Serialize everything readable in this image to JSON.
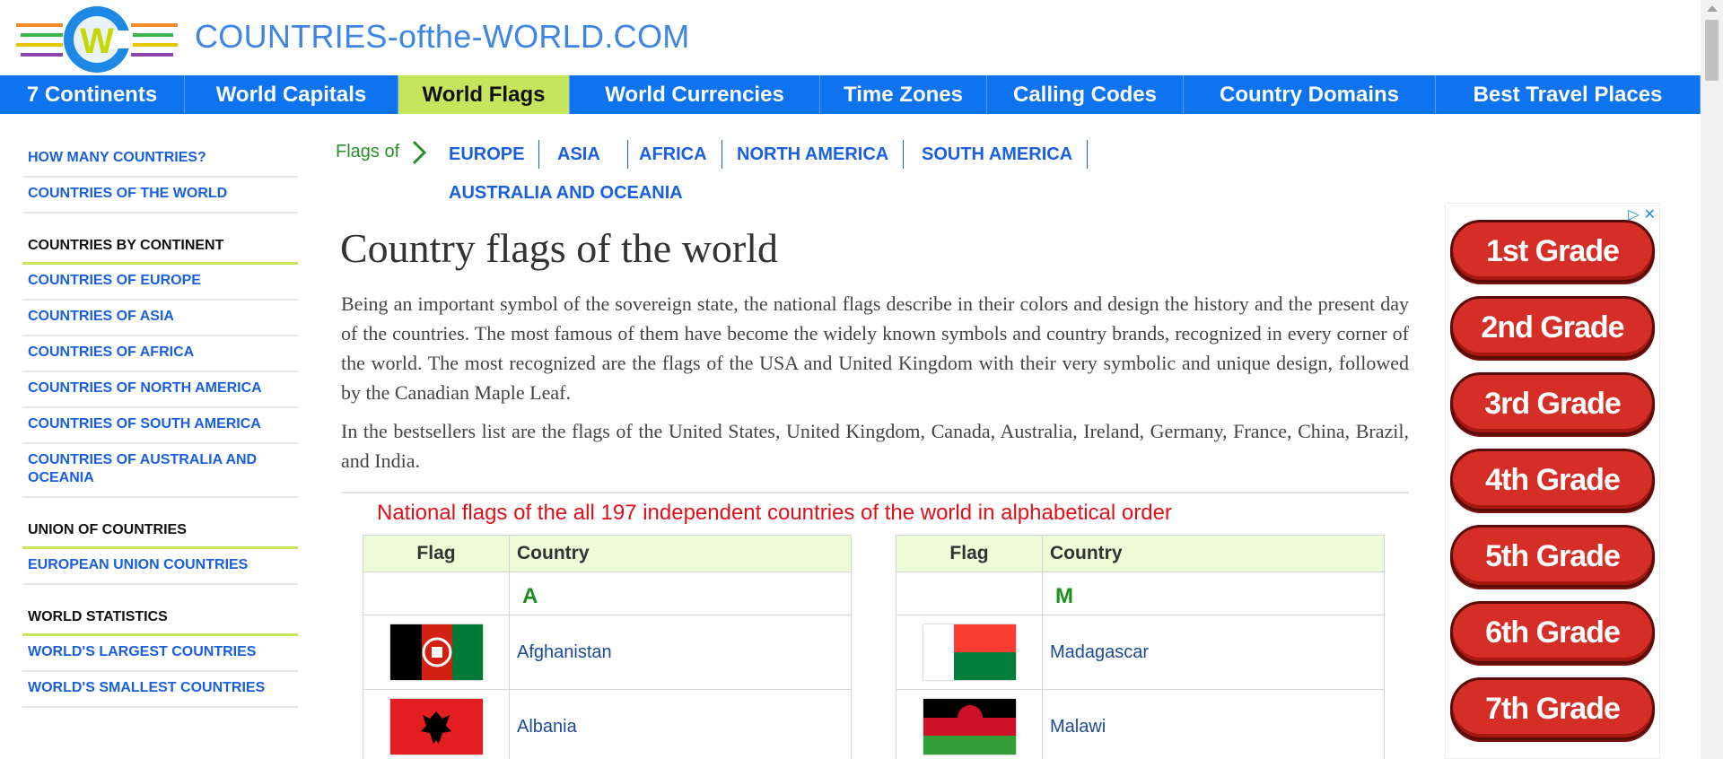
{
  "site": {
    "title": "COUNTRIES-ofthe-WORLD.COM"
  },
  "nav": [
    {
      "label": "7 Continents",
      "w": 206
    },
    {
      "label": "World Capitals",
      "w": 238
    },
    {
      "label": "World Flags",
      "w": 191,
      "active": true
    },
    {
      "label": "World Currencies",
      "w": 279
    },
    {
      "label": "Time Zones",
      "w": 186
    },
    {
      "label": "Calling Codes",
      "w": 219
    },
    {
      "label": "Country Domains",
      "w": 281
    },
    {
      "label": "Best Travel Places",
      "w": 295
    }
  ],
  "sidebar": {
    "links_top": [
      "HOW MANY COUNTRIES?",
      "COUNTRIES OF THE WORLD"
    ],
    "section1": {
      "head": "COUNTRIES BY CONTINENT",
      "links": [
        "COUNTRIES OF EUROPE",
        "COUNTRIES OF ASIA",
        "COUNTRIES OF AFRICA",
        "COUNTRIES OF NORTH AMERICA",
        "COUNTRIES OF SOUTH AMERICA",
        "COUNTRIES OF AUSTRALIA AND OCEANIA"
      ]
    },
    "section2": {
      "head": "UNION OF COUNTRIES",
      "links": [
        "EUROPEAN UNION COUNTRIES"
      ]
    },
    "section3": {
      "head": "WORLD STATISTICS",
      "links": [
        "WORLD'S LARGEST COUNTRIES",
        "WORLD'S SMALLEST COUNTRIES"
      ]
    }
  },
  "crumbs": {
    "label": "Flags of",
    "links": [
      "EUROPE",
      "ASIA",
      "AFRICA",
      "NORTH AMERICA",
      "SOUTH AMERICA",
      "AUSTRALIA AND OCEANIA"
    ]
  },
  "main": {
    "title": "Country flags of the world",
    "para1": "Being an important symbol of the sovereign state, the national flags describe in their colors and design the history and the present day of the countries. The most famous of them have become the widely known symbols and country brands, recognized in every corner of the world. The most recognized are the flags of the USA and United Kingdom with their very symbolic and unique design, followed by the Canadian Maple Leaf.",
    "para2": "In the bestsellers list are the flags of the United States, United Kingdom, Canada, Australia, Ireland, Germany, France, China, Brazil, and India.",
    "list_title": "National flags of the all 197 independent countries of the world in alphabetical order"
  },
  "tables": {
    "col_flag": "Flag",
    "col_country": "Country",
    "left": {
      "letter": "A",
      "rows": [
        "Afghanistan",
        "Albania"
      ]
    },
    "right": {
      "letter": "M",
      "rows": [
        "Madagascar",
        "Malawi"
      ]
    }
  },
  "ad": {
    "buttons": [
      "1st Grade",
      "2nd Grade",
      "3rd Grade",
      "4th Grade",
      "5th Grade",
      "6th Grade",
      "7th Grade"
    ]
  }
}
